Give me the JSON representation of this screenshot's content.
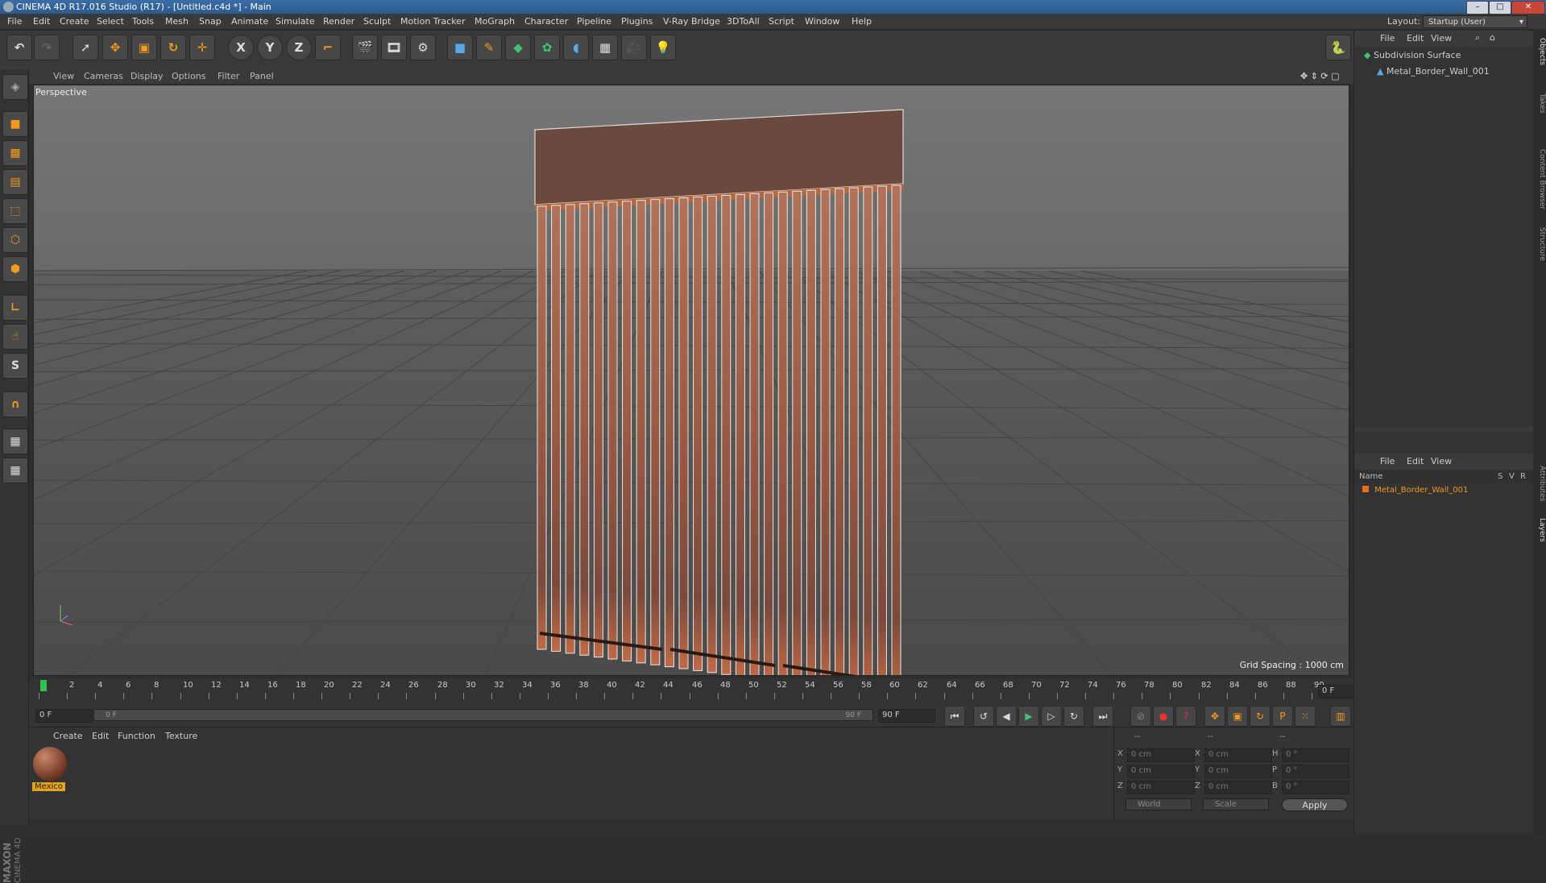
{
  "window": {
    "title": "CINEMA 4D R17.016 Studio (R17) - [Untitled.c4d *] - Main"
  },
  "menubar": {
    "items": [
      "File",
      "Edit",
      "Create",
      "Select",
      "Tools",
      "Mesh",
      "Snap",
      "Animate",
      "Simulate",
      "Render",
      "Sculpt",
      "Motion Tracker",
      "MoGraph",
      "Character",
      "Pipeline",
      "Plugins",
      "V-Ray Bridge",
      "3DToAll",
      "Script",
      "Window",
      "Help"
    ],
    "layout_label": "Layout:",
    "layout_value": "Startup (User)"
  },
  "toolbar": {
    "axis_x": "X",
    "axis_y": "Y",
    "axis_z": "Z"
  },
  "viewport": {
    "menu": [
      "View",
      "Cameras",
      "Display",
      "Options",
      "Filter",
      "Panel"
    ],
    "label": "Perspective",
    "grid_spacing": "Grid Spacing : 1000 cm"
  },
  "timeline": {
    "ticks": [
      "0",
      "2",
      "4",
      "6",
      "8",
      "10",
      "12",
      "14",
      "16",
      "18",
      "20",
      "22",
      "24",
      "26",
      "28",
      "30",
      "32",
      "34",
      "36",
      "38",
      "40",
      "42",
      "44",
      "46",
      "48",
      "50",
      "52",
      "54",
      "56",
      "58",
      "60",
      "62",
      "64",
      "66",
      "68",
      "70",
      "72",
      "74",
      "76",
      "78",
      "80",
      "82",
      "84",
      "86",
      "88",
      "90"
    ],
    "current_frame": "0 F",
    "start_frame": "0 F",
    "slider_start": "0 F",
    "slider_end": "90 F",
    "end_frame": "90 F"
  },
  "material_manager": {
    "menu": [
      "Create",
      "Edit",
      "Function",
      "Texture"
    ],
    "material_name": "Mexico"
  },
  "coordinates": {
    "header": [
      "--",
      "--",
      "--"
    ],
    "rows": [
      {
        "a": "X",
        "av": "0 cm",
        "b": "X",
        "bv": "0 cm",
        "c": "H",
        "cv": "0 °"
      },
      {
        "a": "Y",
        "av": "0 cm",
        "b": "Y",
        "bv": "0 cm",
        "c": "P",
        "cv": "0 °"
      },
      {
        "a": "Z",
        "av": "0 cm",
        "b": "Z",
        "bv": "0 cm",
        "c": "B",
        "cv": "0 °"
      }
    ],
    "mode1": "World",
    "mode2": "Scale",
    "apply": "Apply"
  },
  "object_manager": {
    "menu": [
      "File",
      "Edit",
      "View"
    ],
    "objects": [
      "Subdivision Surface",
      "Metal_Border_Wall_001"
    ]
  },
  "layer_manager": {
    "menu": [
      "File",
      "Edit",
      "View"
    ],
    "col_name": "Name",
    "col_s": "S",
    "col_v": "V",
    "col_r": "R",
    "layer": "Metal_Border_Wall_001"
  },
  "right_tabs": [
    "Objects",
    "Takes",
    "Content Browser",
    "Structure",
    "Attributes",
    "Layers"
  ],
  "brand": {
    "maxon": "MAXON",
    "c4d": "CINEMA 4D"
  },
  "colors": {
    "accent": "#f39a1e",
    "selection": "#e8a31a"
  }
}
